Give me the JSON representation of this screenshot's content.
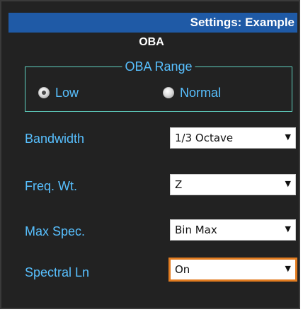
{
  "window": {
    "title": "Settings: Example"
  },
  "section": {
    "title": "OBA"
  },
  "oba_range": {
    "legend": "OBA Range",
    "options": [
      {
        "label": "Low",
        "selected": true
      },
      {
        "label": "Normal",
        "selected": false
      }
    ]
  },
  "settings": [
    {
      "label": "Bandwidth",
      "value": "1/3 Octave",
      "focused": false
    },
    {
      "label": "Freq. Wt.",
      "value": "Z",
      "focused": false
    },
    {
      "label": "Max Spec.",
      "value": "Bin Max",
      "focused": false
    },
    {
      "label": "Spectral Ln",
      "value": "On",
      "focused": true
    }
  ],
  "colors": {
    "panel_bg": "#222222",
    "title_bar": "#1f5aa6",
    "label_blue": "#58c0ff",
    "fieldset_border": "#5fd0c0",
    "focus_orange": "#e27c20"
  },
  "icons": {
    "dropdown": "triangle-down-icon",
    "radio": "radio-button-icon"
  }
}
